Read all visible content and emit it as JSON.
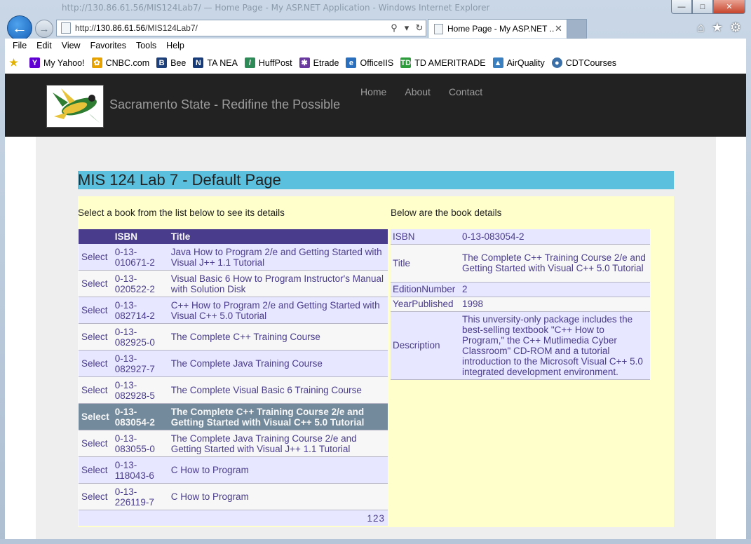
{
  "browser": {
    "titlebar_text": "http://130.86.61.56/MIS124Lab7/ — Home Page - My ASP.NET Application - Windows Internet Explorer",
    "address": {
      "prefix": "http://",
      "host": "130.86.61.56",
      "path": "/MIS124Lab7/"
    },
    "tab_label": "Home Page - My ASP.NET ...",
    "menu": [
      "File",
      "Edit",
      "View",
      "Favorites",
      "Tools",
      "Help"
    ],
    "favorites": [
      {
        "label": "My Yahoo!",
        "icon": "yahoo-icon",
        "color": "#5f01d1"
      },
      {
        "label": "CNBC.com",
        "icon": "cnbc-peacock-icon",
        "color": "#e8a200"
      },
      {
        "label": "Bee",
        "icon": "bee-b-icon",
        "color": "#1d3f7a"
      },
      {
        "label": "TA NEA",
        "icon": "ta-nea-n-icon",
        "color": "#173a78"
      },
      {
        "label": "HuffPost",
        "icon": "huffpost-icon",
        "color": "#2e8b57"
      },
      {
        "label": "Etrade",
        "icon": "etrade-icon",
        "color": "#6a3aa0"
      },
      {
        "label": "OfficeIIS",
        "icon": "ie-icon",
        "color": "#2a6fbd"
      },
      {
        "label": "TD AMERITRADE",
        "icon": "td-ameritrade-icon",
        "color": "#2e9b3c"
      },
      {
        "label": "AirQuality",
        "icon": "airquality-icon",
        "color": "#3a7fc0"
      },
      {
        "label": "CDTCourses",
        "icon": "cdt-icon",
        "color": "#3b6fa8"
      }
    ]
  },
  "site": {
    "brand": "Sacramento State - Redifine the Possible",
    "nav": [
      "Home",
      "About",
      "Contact"
    ]
  },
  "page": {
    "heading": "MIS 124 Lab 7 - Default Page",
    "instruction_left": "Select a book from the list below to see its details",
    "instruction_right": "Below are the book details",
    "grid": {
      "headers": [
        "",
        "ISBN",
        "Title"
      ],
      "rows": [
        {
          "action": "Select",
          "isbn": "0-13-010671-2",
          "title": "Java How to Program 2/e and Getting Started with Visual J++ 1.1 Tutorial"
        },
        {
          "action": "Select",
          "isbn": "0-13-020522-2",
          "title": "Visual Basic 6 How to Program Instructor's Manual with Solution Disk"
        },
        {
          "action": "Select",
          "isbn": "0-13-082714-2",
          "title": "C++ How to Program 2/e and Getting Started with Visual C++ 5.0 Tutorial"
        },
        {
          "action": "Select",
          "isbn": "0-13-082925-0",
          "title": "The Complete C++ Training Course"
        },
        {
          "action": "Select",
          "isbn": "0-13-082927-7",
          "title": "The Complete Java Training Course"
        },
        {
          "action": "Select",
          "isbn": "0-13-082928-5",
          "title": "The Complete Visual Basic 6 Training Course"
        },
        {
          "action": "Select",
          "isbn": "0-13-083054-2",
          "title": "The Complete C++ Training Course 2/e and Getting Started with Visual C++ 5.0 Tutorial",
          "selected": true
        },
        {
          "action": "Select",
          "isbn": "0-13-083055-0",
          "title": "The Complete Java Training Course 2/e and Getting Started with Visual J++ 1.1 Tutorial"
        },
        {
          "action": "Select",
          "isbn": "0-13-118043-6",
          "title": "C How to Program"
        },
        {
          "action": "Select",
          "isbn": "0-13-226119-7",
          "title": "C How to Program"
        }
      ],
      "pager": [
        "1",
        "2",
        "3"
      ]
    },
    "details": [
      {
        "key": "ISBN",
        "value": "0-13-083054-2"
      },
      {
        "key": "Title",
        "value": "The Complete C++ Training Course 2/e and Getting Started with Visual C++ 5.0 Tutorial"
      },
      {
        "key": "EditionNumber",
        "value": "2"
      },
      {
        "key": "YearPublished",
        "value": "1998"
      },
      {
        "key": "Description",
        "value": "This unversity-only package includes the best-selling textbook \"C++ How to Program,\" the C++ Mutlimedia Cyber Classroom\" CD-ROM and a tutorial introduction to the Microsoft Visual C++ 5.0 integrated development environment."
      }
    ]
  },
  "colors": {
    "grid_header": "#4a3c8c",
    "grid_row_alt": "#e7e7ff",
    "grid_selected": "#738a9c",
    "heading_bg": "#5bc0de",
    "panel_bg": "#ffffcc",
    "navbar_bg": "#222222"
  }
}
